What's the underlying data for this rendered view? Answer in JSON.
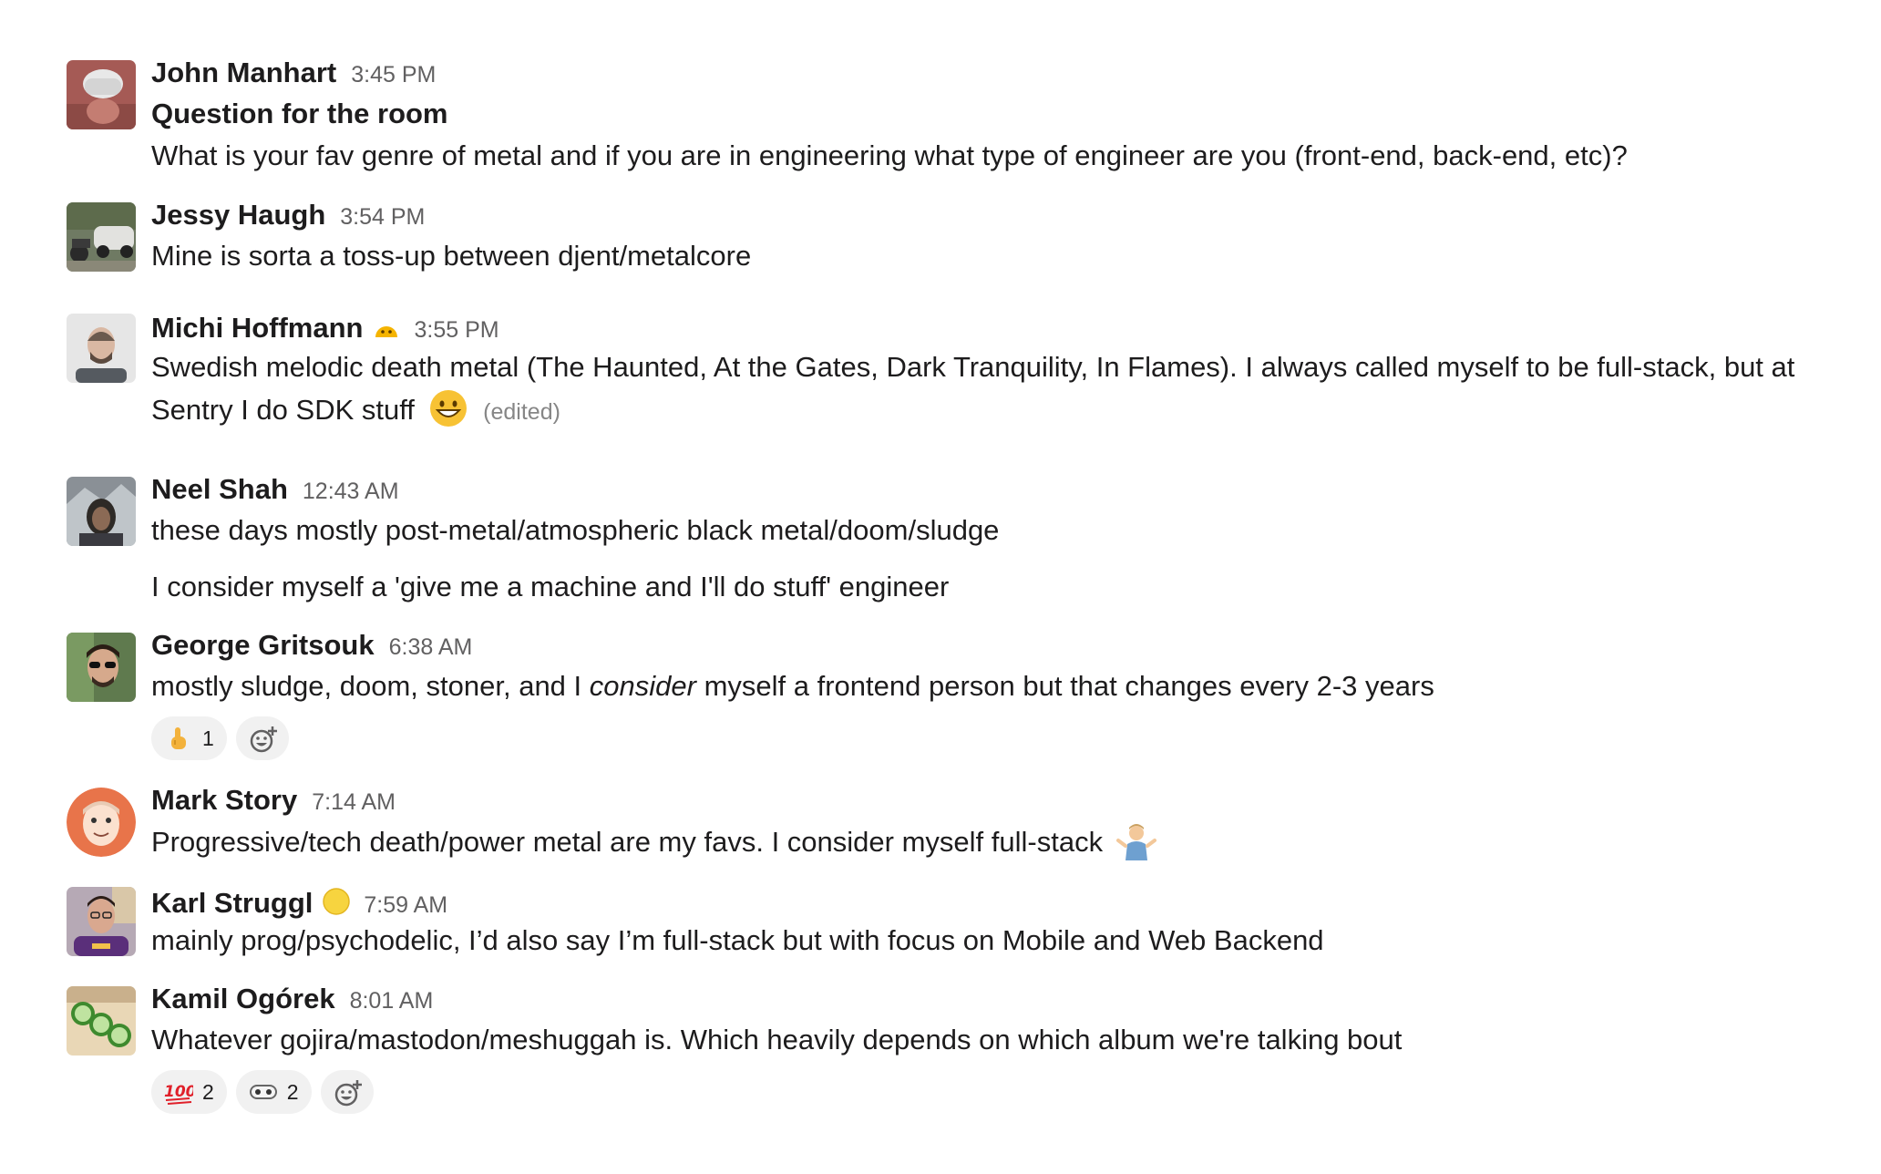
{
  "messages": [
    {
      "name": "John Manhart",
      "time": "3:45 PM",
      "lines": [
        "Question for the room",
        "What is your fav genre of metal and if you are in engineering what type of engineer are you (front-end, back-end, etc)?"
      ]
    },
    {
      "name": "Jessy Haugh",
      "time": "3:54 PM",
      "lines": [
        "Mine is sorta a toss-up between djent/metalcore"
      ]
    },
    {
      "name": "Michi Hoffmann",
      "time": "3:55 PM",
      "status_icon": "face-emoji-icon",
      "text": "Swedish melodic death metal (The Haunted, At the Gates, Dark Tranquility, In Flames). I always called myself to be full-stack, but at Sentry I do SDK stuff",
      "inline_emoji": "grinning-face-icon",
      "edited": "(edited)"
    },
    {
      "name": "Neel Shah",
      "time": "12:43 AM",
      "lines": [
        "these days mostly post-metal/atmospheric black metal/doom/sludge",
        "I consider myself a 'give me a machine and I'll do stuff' engineer"
      ]
    },
    {
      "name": "George Gritsouk",
      "time": "6:38 AM",
      "text_before": "mostly sludge, doom, stoner, and I ",
      "text_italic": "consider",
      "text_after": " myself a frontend person but that changes every 2-3 years",
      "reactions": [
        {
          "emoji": "point-up-icon",
          "count": "1"
        }
      ]
    },
    {
      "name": "Mark Story",
      "time": "7:14 AM",
      "text": "Progressive/tech death/power metal are my favs. I consider myself full-stack",
      "inline_emoji": "shrug-person-icon"
    },
    {
      "name": "Karl Struggl",
      "time": "7:59 AM",
      "status_icon": "yellow-circle-icon",
      "lines": [
        "mainly prog/psychodelic, I’d also say I’m full-stack but with focus on Mobile and Web Backend"
      ]
    },
    {
      "name": "Kamil Ogórek",
      "time": "8:01 AM",
      "lines": [
        "Whatever gojira/mastodon/meshuggah is. Which heavily depends on which album we're talking bout"
      ],
      "reactions": [
        {
          "emoji": "hundred-points-icon",
          "count": "2"
        },
        {
          "emoji": "eyes-face-icon",
          "count": "2"
        }
      ]
    }
  ],
  "colors": {
    "text": "#1d1c1d",
    "timestamp": "#616061",
    "reaction_bg": "#f1f1f1"
  }
}
